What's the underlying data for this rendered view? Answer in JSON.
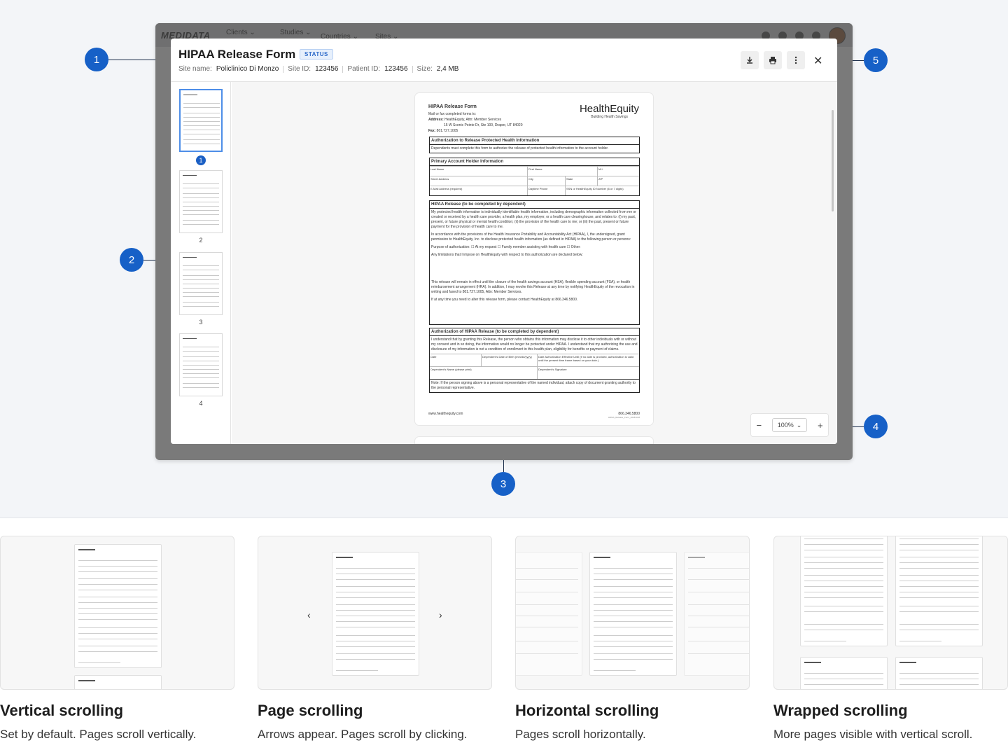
{
  "app": {
    "logo": "MEDIDATA",
    "nav": [
      {
        "label": "Clients",
        "sub": "..."
      },
      {
        "label": "Studies",
        "sub": "..."
      },
      {
        "label": "Countries"
      },
      {
        "label": "Sites"
      }
    ]
  },
  "modal": {
    "title": "HIPAA Release Form",
    "status": "STATUS",
    "meta": {
      "site_name_label": "Site name:",
      "site_name": "Policlinico Di Monzo",
      "site_id_label": "Site ID:",
      "site_id": "123456",
      "patient_id_label": "Patient ID:",
      "patient_id": "123456",
      "size_label": "Size:",
      "size": "2,4 MB"
    },
    "actions": {
      "download": "download-icon",
      "print": "print-icon",
      "more": "more-vertical-icon",
      "close": "✕"
    }
  },
  "thumbnails": [
    "1",
    "2",
    "3",
    "4"
  ],
  "document": {
    "title": "HIPAA Release Form",
    "sub1": "Mail or fax completed forms to:",
    "address_label": "Address:",
    "address1": "HealthEquity, Attn: Member Services",
    "address2": "15 W Scenic Pointe Dr, Ste 100, Draper, UT 84020",
    "fax_label": "Fax:",
    "fax": "801.727.1005",
    "brand": "HealthEquity",
    "brand_tag": "Building Health Savings",
    "sec1_title": "Authorization to Release Protected Health Information",
    "sec1_text": "Dependents must complete this form to authorize the release of protected health information to the account holder.",
    "sec2_title": "Primary Account Holder Information",
    "sec2_fields": [
      "Last Name",
      "First Name",
      "M.I.",
      "Street Address",
      "City",
      "State",
      "ZIP",
      "E-Mail Address (required)",
      "Daytime Phone",
      "SSN or HealthEquity ID Number (6 or 7 digits)"
    ],
    "sec3_title": "HIPAA Release (to be completed by dependent)",
    "sec3_p1": "My protected health information is individually identifiable health information, including demographic information collected from me or created or received by a health care provider, a health plan, my employer, or a health care clearinghouse, and relates to: (i) my past, present, or future physical or mental health condition; (ii) the provision of the health care to me; or (iii) the past, present or future payment for the provision of health care to me.",
    "sec3_p2": "In accordance with the provisions of the Health Insurance Portability and Accountability Act (HIPAA), I, the undersigned, grant permission to HealthEquity, Inc. to disclose protected health information (as defined in HIPAA) to the following person or persons:",
    "sec3_p3": "Purpose of authorization:  ☐ At my request   ☐ Family member assisting with health care   ☐ Other:",
    "sec3_p4": "Any limitations that I impose on HealthEquity with respect to this authorization are declared below:",
    "sec3_p5": "This release will remain in effect until the closure of the health savings account (HSA), flexible spending account (FSA), or health reimbursement arrangement (HRA). In addition, I may revoke this Release at any time by notifying HealthEquity of the revocation in writing and faxed to 801.727.1005, Attn: Member Services.",
    "sec3_p6": "If at any time you need to alter this release form, please contact HealthEquity at 866.346.5800.",
    "sec4_title": "Authorization of HIPAA Release (to be completed by dependent)",
    "sec4_p1": "I understand that by granting this Release, the person who obtains this information may disclose it to other individuals with or without my consent and in so doing, the information would no longer be protected under HIPAA. I understand that my authorizing the use and disclosure of my information is not a condition of enrollment in this health plan, eligibility for benefits or payment of claims.",
    "sec4_fields": [
      "Date",
      "Dependent's Date of Birth (mm/dd/yyyy)",
      "Date Authorization Effective Until (if no date is provided, authorization is valid until the present time frame based on your date.)",
      "Dependent's Name (please print)",
      "Dependent's Signature"
    ],
    "sec4_note": "Note: If the person signing above is a personal representative of the named individual, attach copy of document granting authority to the personal representative.",
    "footer_url": "www.healthequity.com",
    "footer_phone": "866.346.5800",
    "footer_code": "HIPAA_Release_Form_20181018"
  },
  "zoom": {
    "minus": "−",
    "value": "100%",
    "plus": "+"
  },
  "callouts": [
    "1",
    "2",
    "3",
    "4",
    "5"
  ],
  "cards": [
    {
      "title": "Vertical scrolling",
      "desc": "Set by default. Pages scroll vertically."
    },
    {
      "title": "Page scrolling",
      "desc": "Arrows appear. Pages scroll by clicking.",
      "prev": "‹",
      "next": "›"
    },
    {
      "title": "Horizontal scrolling",
      "desc": "Pages scroll horizontally."
    },
    {
      "title": "Wrapped scrolling",
      "desc": "More pages visible with vertical scroll."
    }
  ],
  "colors": {
    "accent": "#1660c7",
    "frame": "#7a7a7a",
    "badge": "#2d6ac9"
  }
}
